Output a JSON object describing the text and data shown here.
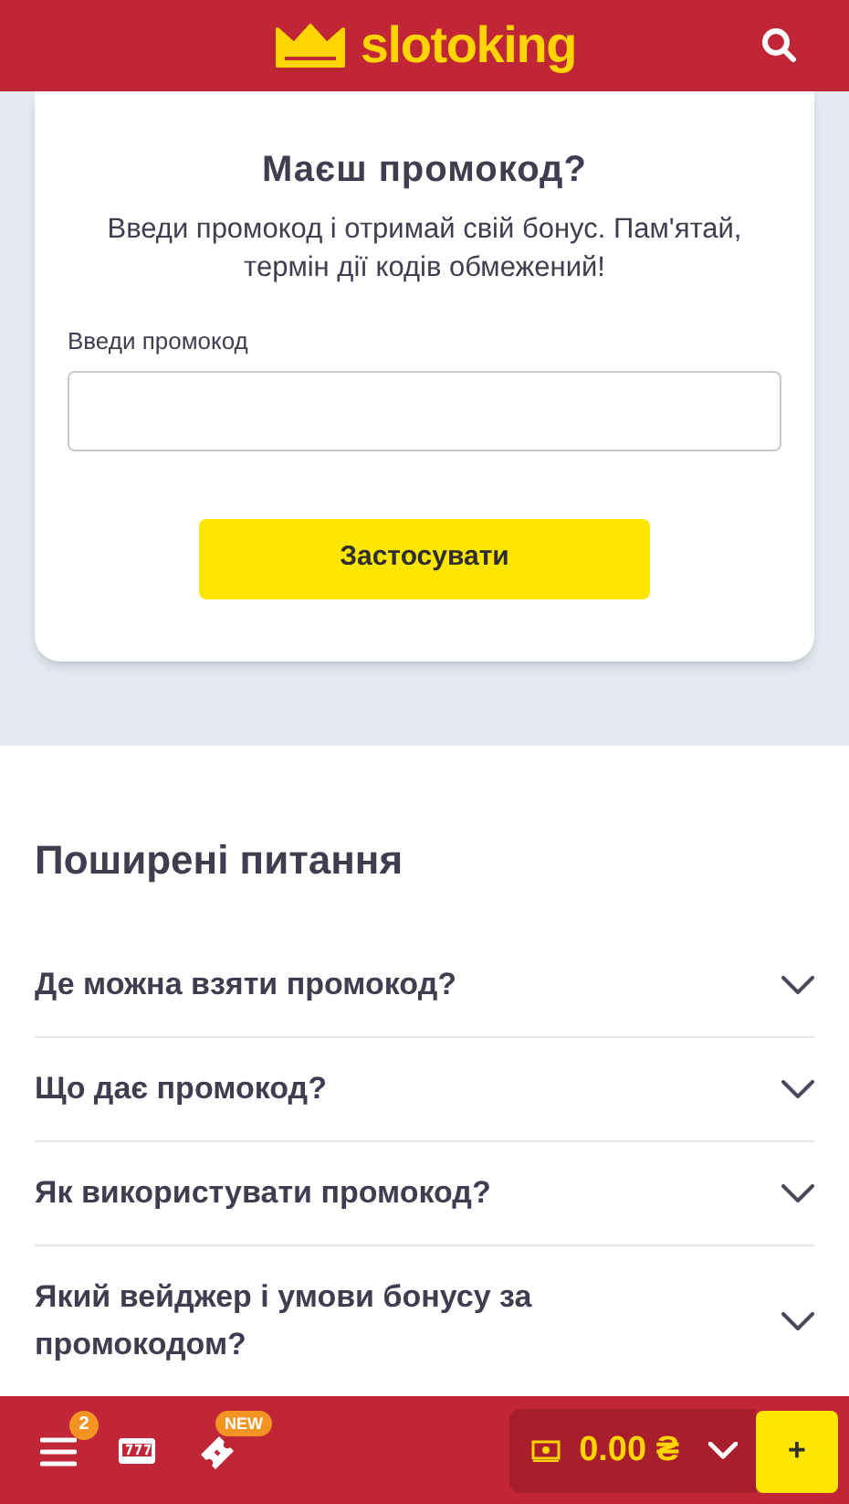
{
  "header": {
    "logo": "slotoking"
  },
  "promo": {
    "title": "Маєш промокод?",
    "description": "Введи промокод і отримай свій бонус. Пам'ятай, термін дії кодів обмежений!",
    "field_label": "Введи промокод",
    "button": "Застосувати"
  },
  "faq": {
    "title": "Поширені питання",
    "items": [
      {
        "question": "Де можна взяти промокод?",
        "expanded": false
      },
      {
        "question": "Що дає промокод?",
        "expanded": false
      },
      {
        "question": "Як використувати промокод?",
        "expanded": false
      },
      {
        "question": "Який вейджер і умови бонусу за промокодом?",
        "expanded": false
      }
    ]
  },
  "bottom_bar": {
    "menu_badge": "2",
    "promo_badge": "NEW",
    "balance": "0.00 ₴",
    "add_button": "+"
  }
}
